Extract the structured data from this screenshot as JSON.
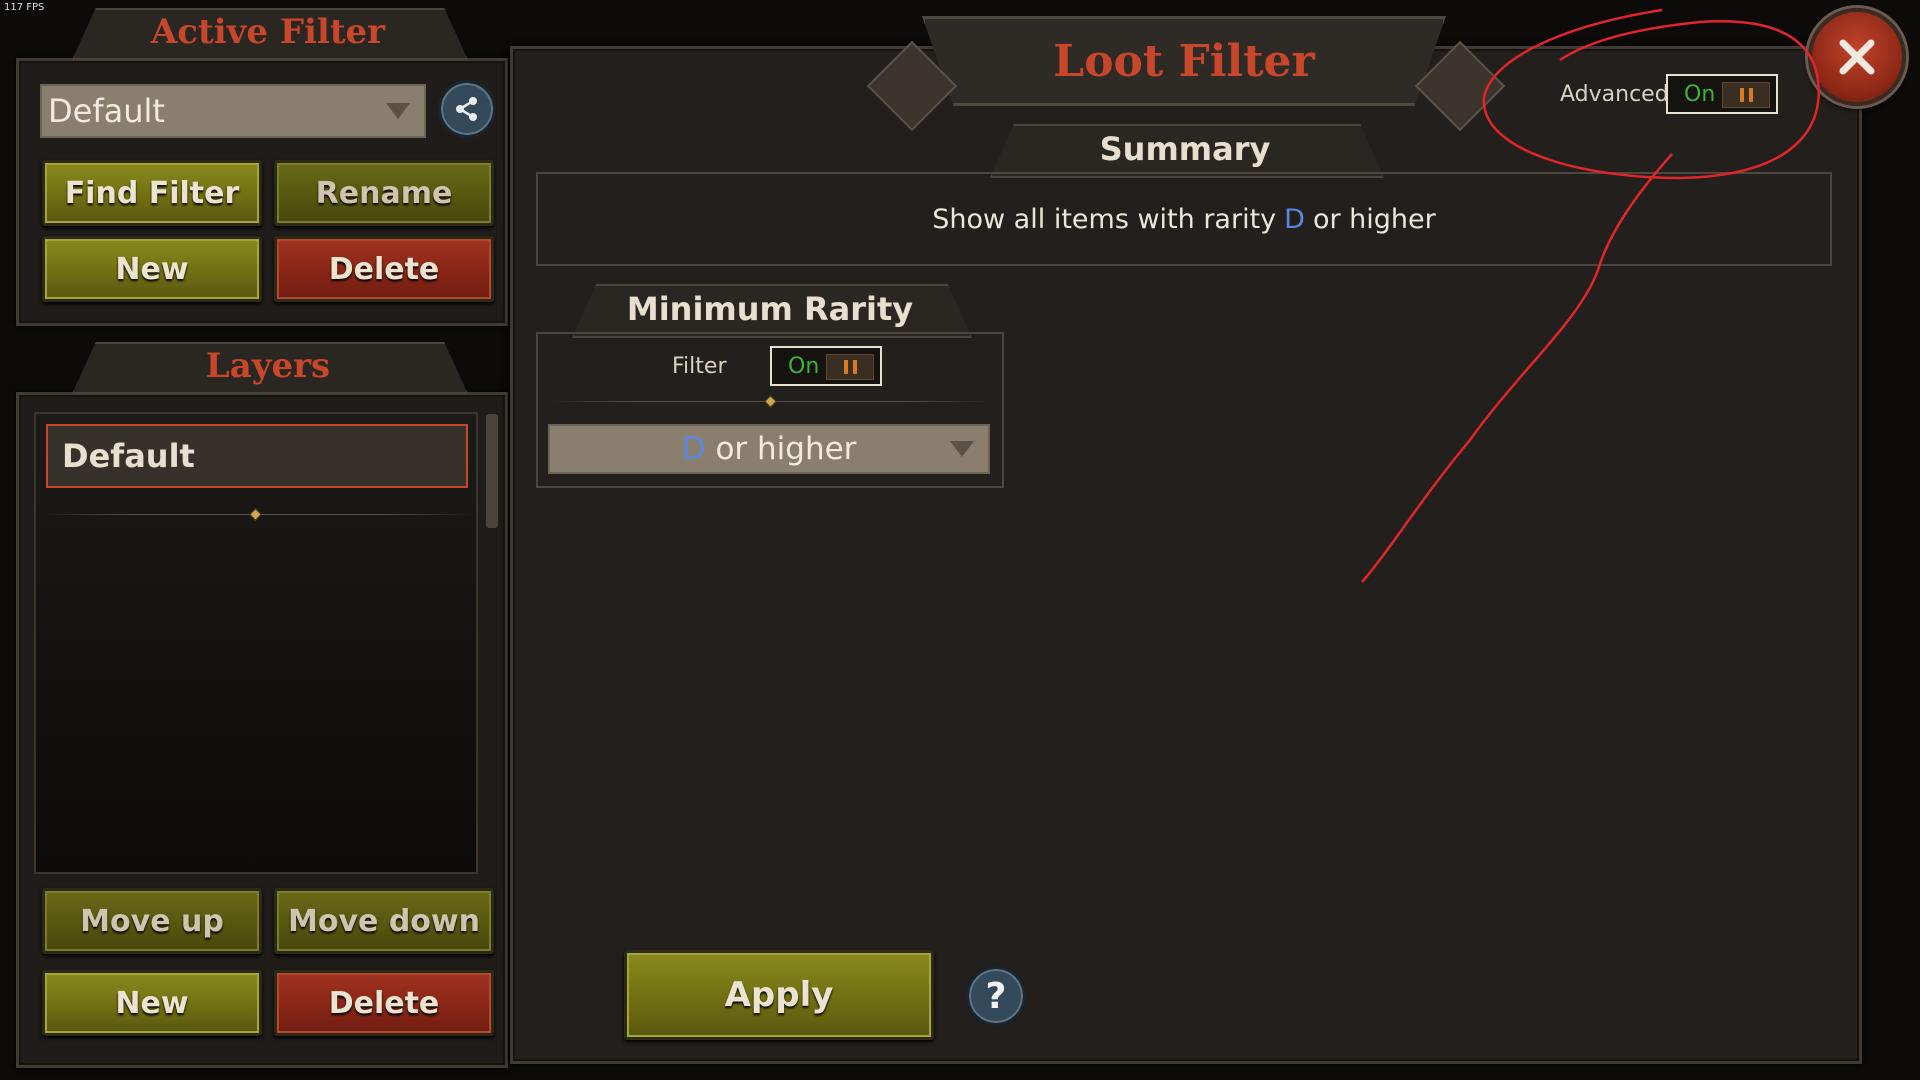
{
  "overlay": {
    "fps": "117 FPS"
  },
  "active_filter": {
    "title": "Active Filter",
    "dropdown_value": "Default",
    "buttons": {
      "find": "Find Filter",
      "rename": "Rename",
      "new": "New",
      "delete": "Delete"
    }
  },
  "layers": {
    "title": "Layers",
    "items": [
      {
        "label": "Default",
        "selected": true
      }
    ],
    "buttons": {
      "move_up": "Move up",
      "move_down": "Move down",
      "new": "New",
      "delete": "Delete"
    }
  },
  "main": {
    "title": "Loot Filter",
    "advanced": {
      "label": "Advanced",
      "state": "On"
    },
    "summary": {
      "title": "Summary",
      "text_prefix": "Show all items with rarity",
      "rarity": "D",
      "text_suffix": "or higher"
    },
    "minimum_rarity": {
      "title": "Minimum Rarity",
      "filter_label": "Filter",
      "filter_state": "On",
      "rarity": "D",
      "rarity_suffix": "or higher"
    },
    "apply_label": "Apply",
    "help_symbol": "?"
  },
  "colors": {
    "accent_red": "#c8462a",
    "rarity_blue": "#5a86e0",
    "on_green": "#3db33a",
    "annotation": "#e0262a"
  },
  "icons": [
    "share-icon",
    "close-icon",
    "help-icon",
    "caret-down-icon"
  ]
}
